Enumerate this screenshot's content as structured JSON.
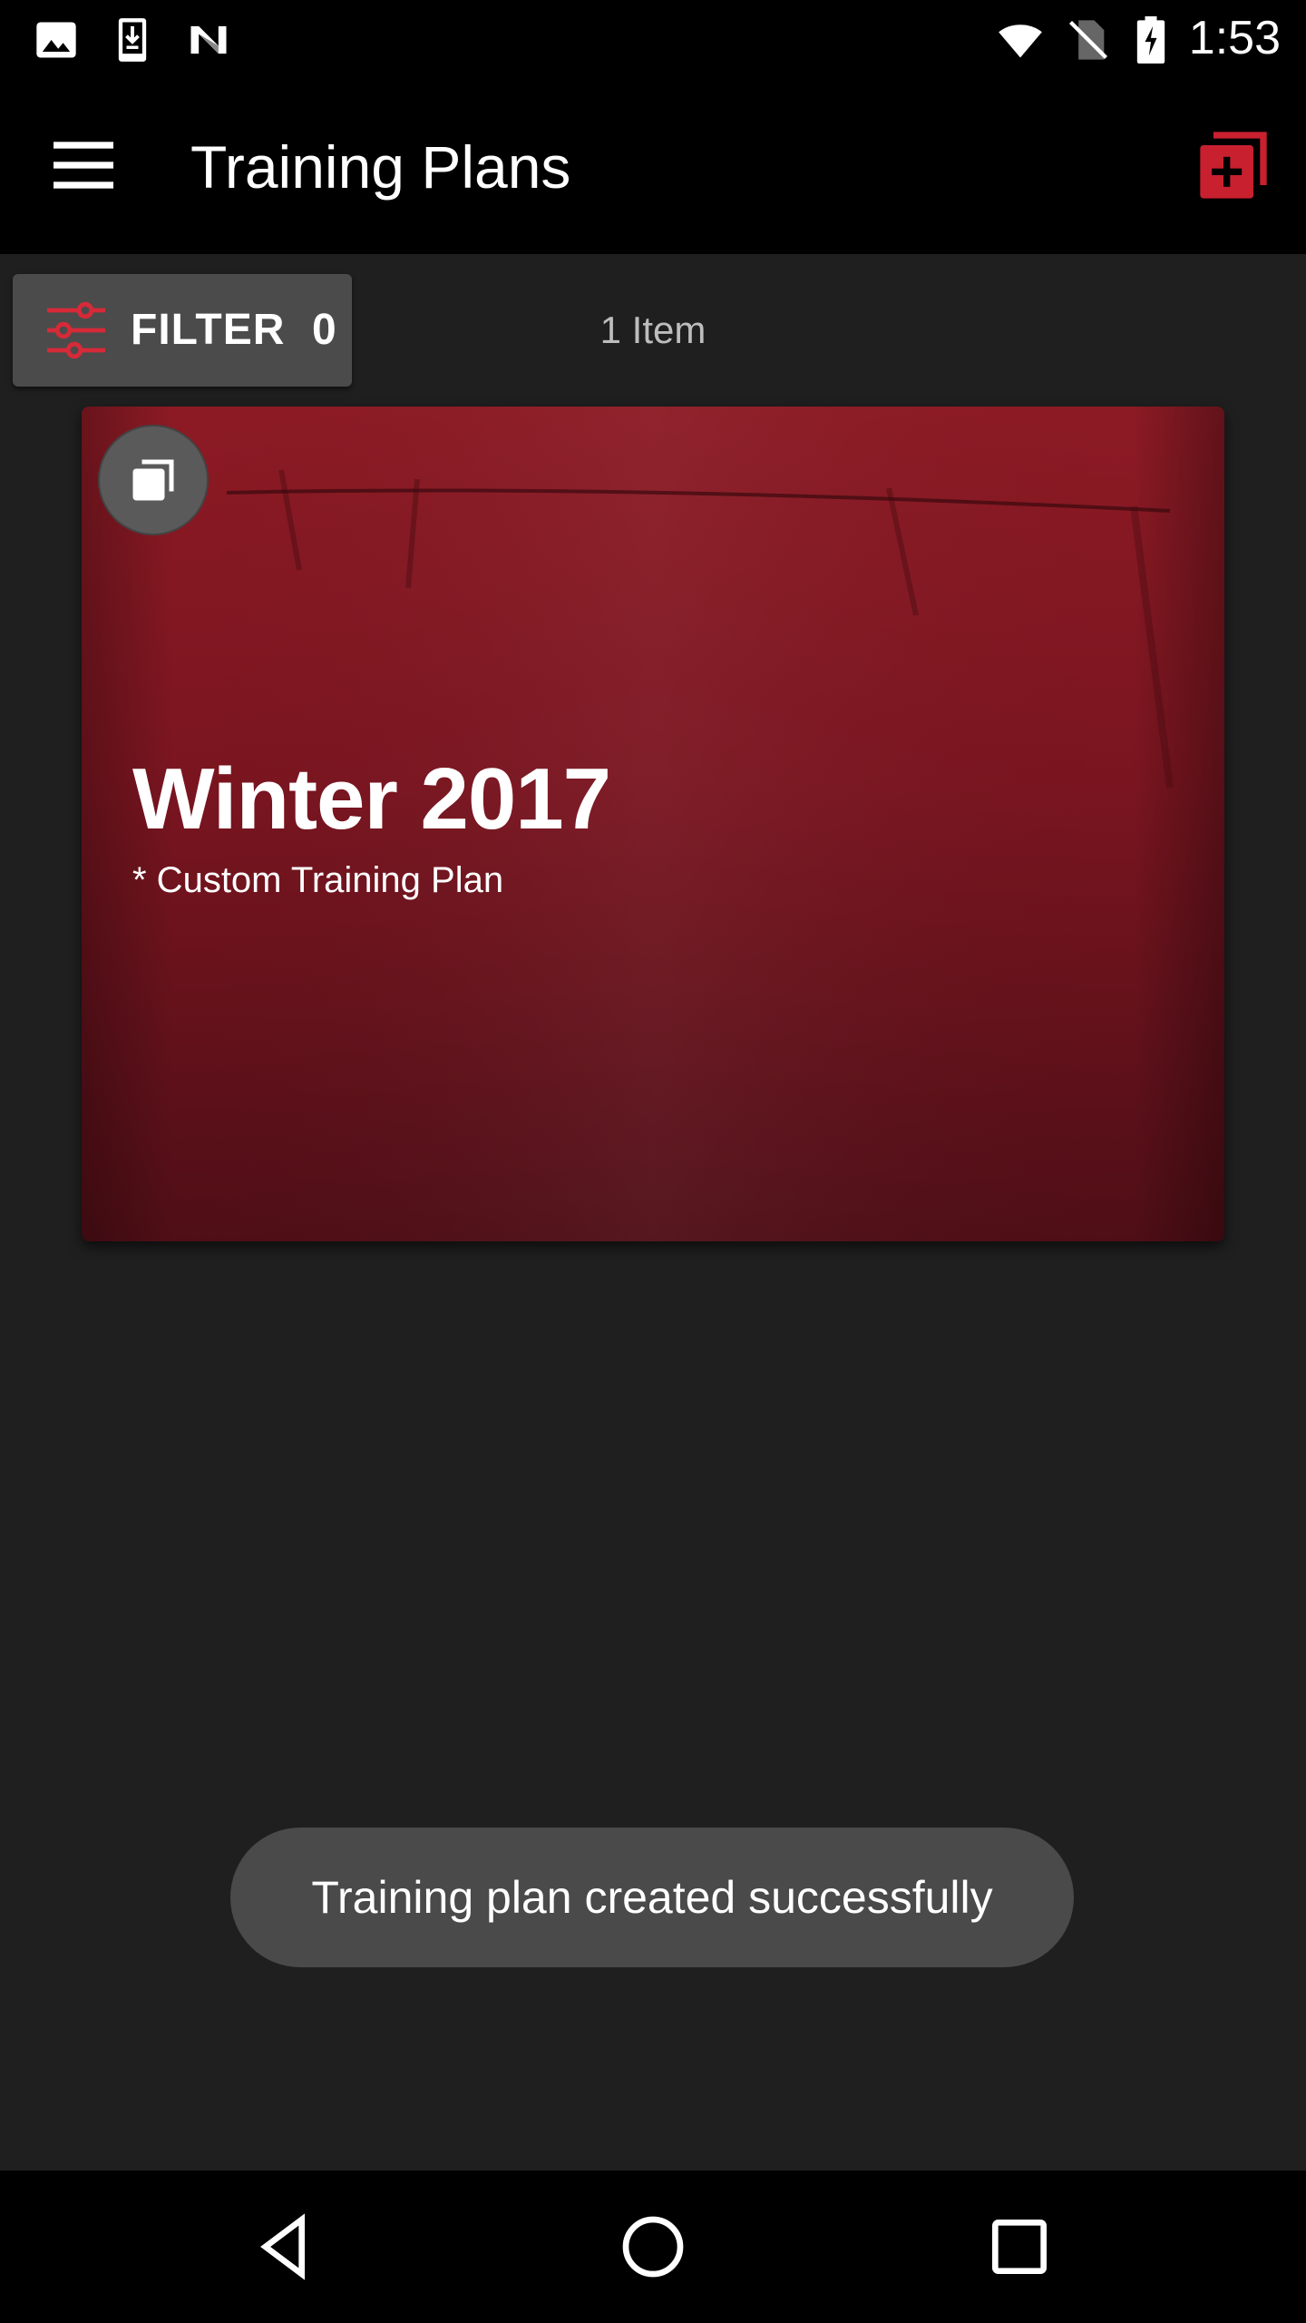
{
  "status_bar": {
    "time": "1:53",
    "left_icons": [
      "image-icon",
      "download-icon",
      "n-logo-icon"
    ],
    "right_icons": [
      "wifi-icon",
      "no-sim-icon",
      "battery-charging-icon"
    ]
  },
  "app_bar": {
    "title": "Training Plans",
    "menu_icon": "menu-icon",
    "action_icon": "add-collection-icon",
    "accent_color": "#c8202f"
  },
  "filter": {
    "label": "FILTER",
    "count": "0",
    "icon": "sliders-icon"
  },
  "item_count": "1 Item",
  "plans": [
    {
      "title": "Winter 2017",
      "subtitle": "* Custom Training Plan",
      "badge_icon": "stack-icon",
      "background_color": "#7a1520"
    }
  ],
  "toast": {
    "message": "Training plan created successfully"
  },
  "nav_bar": {
    "buttons": [
      "back-icon",
      "home-icon",
      "recents-icon"
    ]
  }
}
